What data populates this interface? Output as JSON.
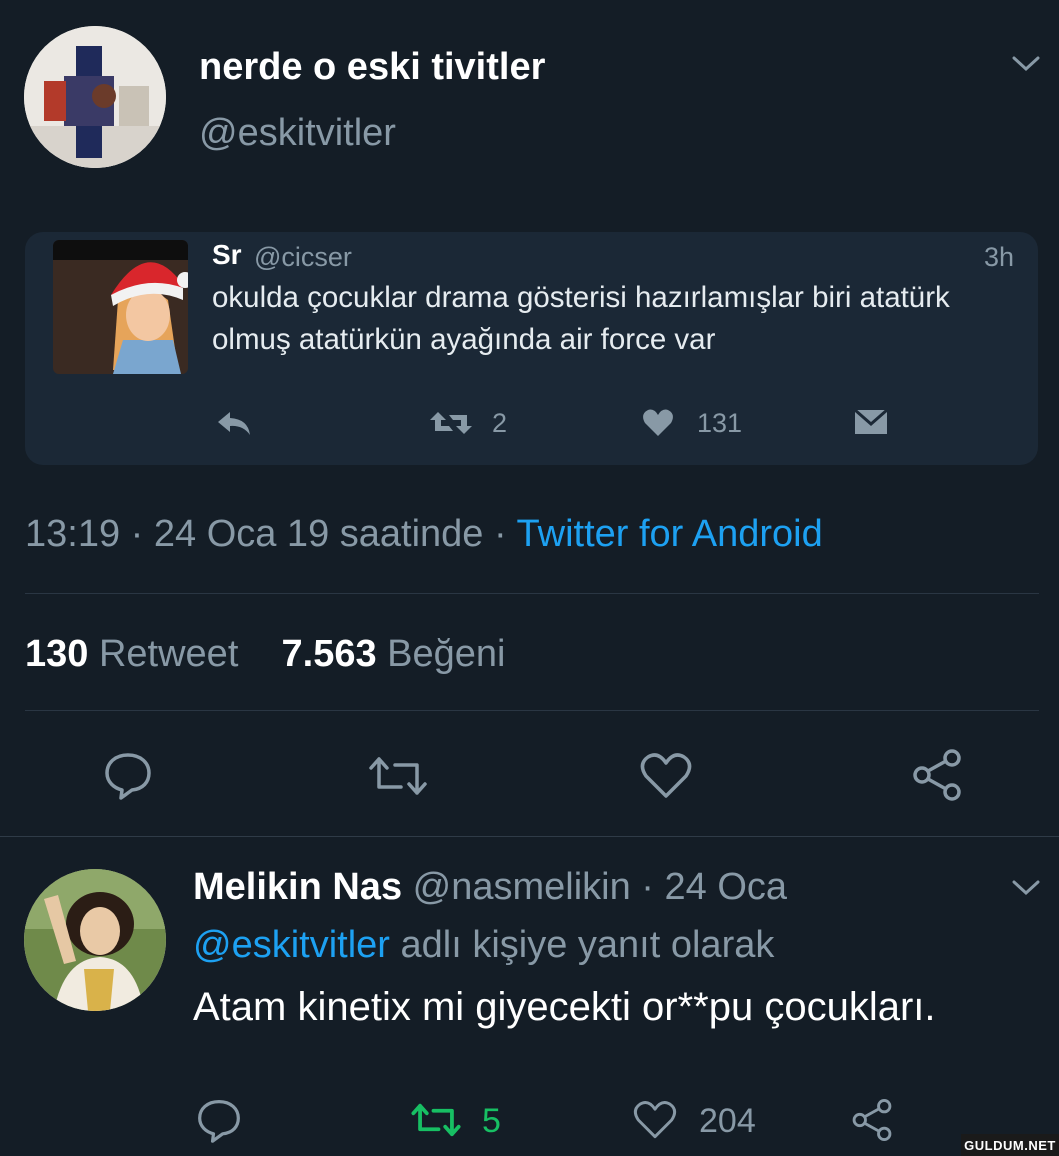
{
  "tweet": {
    "display_name": "nerde o eski tivitler",
    "handle": "@eskitvitler",
    "quote": {
      "display_name": "Sr",
      "handle": "@cicser",
      "time": "3h",
      "text_line1": "okulda çocuklar drama gösterisi hazırlamışlar biri atatürk",
      "text_line2": "olmuş atatürkün ayağında air force var",
      "retweets": "2",
      "likes": "131"
    },
    "timestamp": "13:19 · 24 Oca 19 saatinde · ",
    "source": "Twitter for Android",
    "stats": {
      "retweet_count": "130",
      "retweet_label": "Retweet",
      "like_count": "7.563",
      "like_label": "Beğeni"
    }
  },
  "reply": {
    "display_name": "Melikin Nas",
    "handle_date": "@nasmelikin · 24 Oca",
    "reply_to_handle": "@eskitvitler",
    "reply_to_suffix": " adlı kişiye yanıt olarak",
    "text": "Atam kinetix mi giyecekti or**pu çocukları.",
    "retweets": "5",
    "likes": "204"
  },
  "watermark": "GULDUM.NET",
  "colors": {
    "background": "#141d26",
    "card": "#1b2836",
    "muted": "#8899a6",
    "link": "#1da1f2",
    "retweet_active": "#17bf63"
  }
}
